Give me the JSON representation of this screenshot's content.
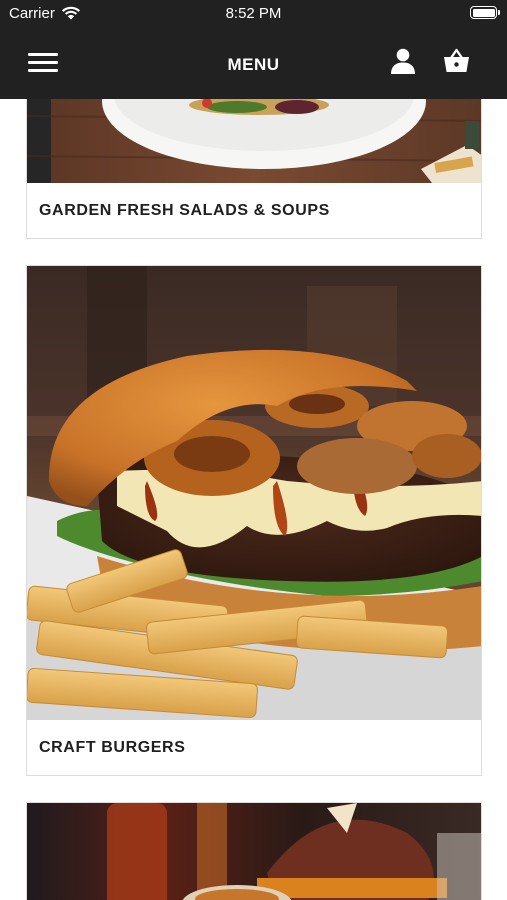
{
  "status_bar": {
    "carrier": "Carrier",
    "time": "8:52 PM"
  },
  "nav": {
    "title": "MENU",
    "menu_icon": "hamburger-menu-icon",
    "user_icon": "user-icon",
    "cart_icon": "basket-icon"
  },
  "categories": [
    {
      "label": "GARDEN FRESH SALADS & SOUPS",
      "image": "salad-photo"
    },
    {
      "label": "CRAFT BURGERS",
      "image": "burger-photo"
    },
    {
      "label": "",
      "image": "appetizer-photo"
    }
  ],
  "colors": {
    "nav_background": "#212121",
    "card_border": "#dcdcdc",
    "label_text": "#1f1f1f"
  }
}
